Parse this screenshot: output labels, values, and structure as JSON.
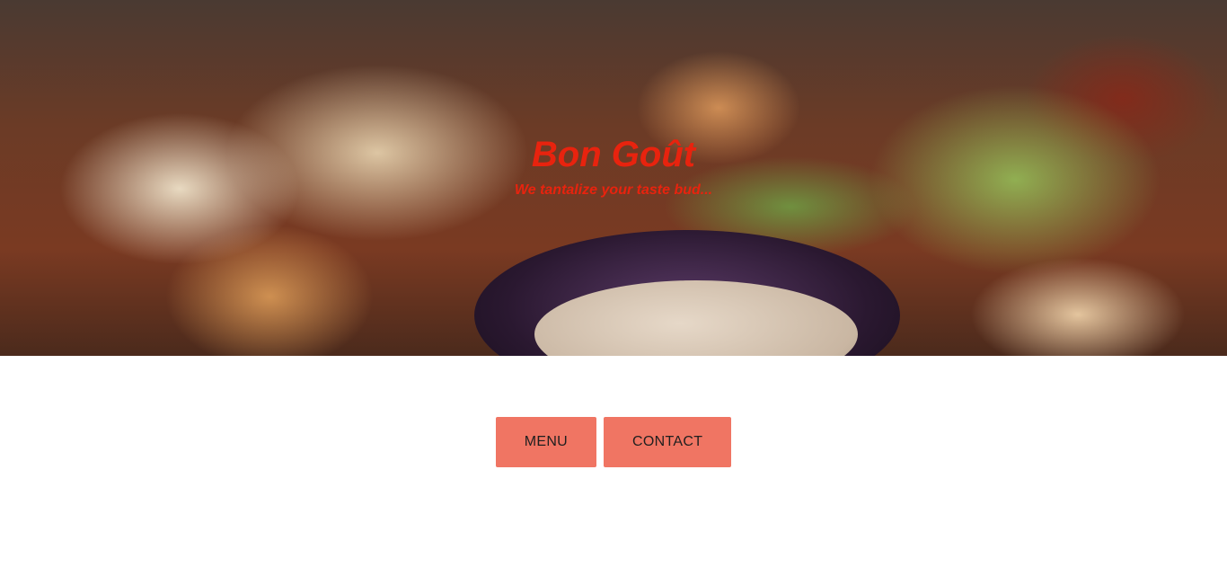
{
  "hero": {
    "title": "Bon Goût",
    "tagline": "We tantalize your taste bud..."
  },
  "nav": {
    "buttons": [
      {
        "label": "MENU"
      },
      {
        "label": "CONTACT"
      }
    ]
  },
  "colors": {
    "title": "#e8230e",
    "button_bg": "#f07563",
    "button_text": "#1f1f1f"
  }
}
